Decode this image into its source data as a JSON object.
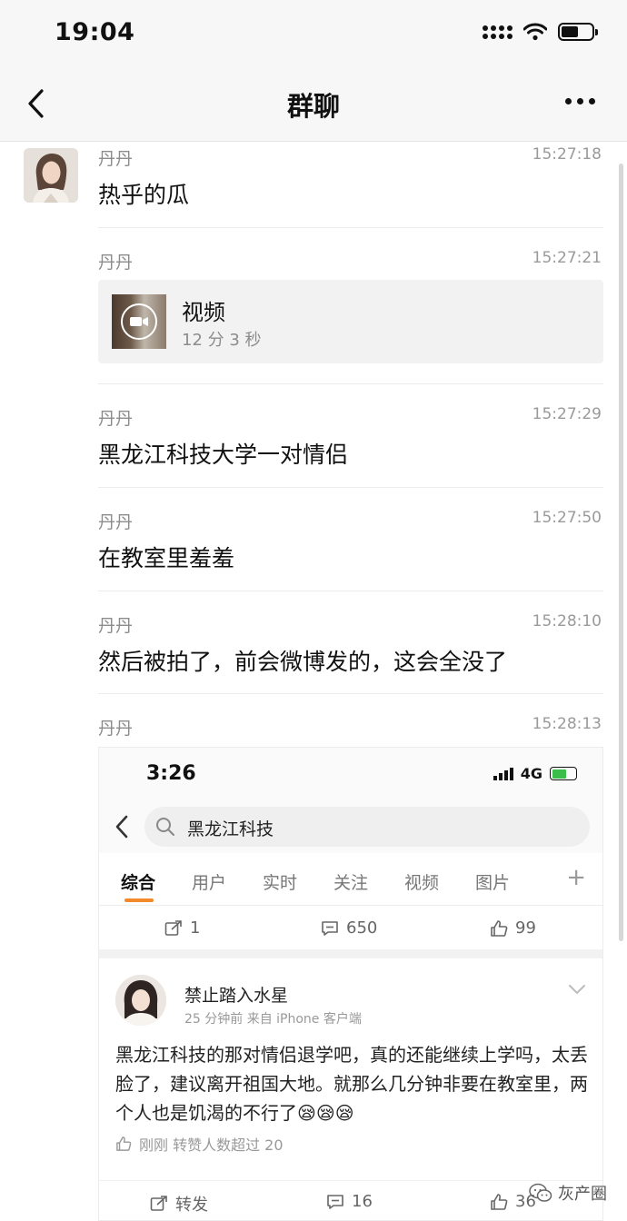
{
  "status_bar": {
    "time": "19:04"
  },
  "nav": {
    "title": "群聊"
  },
  "messages": [
    {
      "sender": "丹丹",
      "time": "15:27:18",
      "text": "热乎的瓜"
    },
    {
      "sender": "丹丹",
      "time": "15:27:21",
      "video": {
        "title": "视频",
        "duration": "12 分 3 秒"
      }
    },
    {
      "sender": "丹丹",
      "time": "15:27:29",
      "text": "黑龙江科技大学一对情侣"
    },
    {
      "sender": "丹丹",
      "time": "15:27:50",
      "text": "在教室里羞羞"
    },
    {
      "sender": "丹丹",
      "time": "15:28:10",
      "text": "然后被拍了，前会微博发的，这会全没了"
    },
    {
      "sender": "丹丹",
      "time": "15:28:13"
    }
  ],
  "screenshot": {
    "time": "3:26",
    "network": "4G",
    "search_query": "黑龙江科技",
    "tabs": [
      "综合",
      "用户",
      "实时",
      "关注",
      "视频",
      "图片"
    ],
    "plus": "+",
    "top_actions": {
      "repost": "1",
      "comments": "650",
      "likes": "99"
    },
    "post": {
      "author": "禁止踏入水星",
      "meta": "25 分钟前  来自 iPhone 客户端",
      "body": "黑龙江科技的那对情侣退学吧，真的还能继续上学吗，太丢脸了，建议离开祖国大地。就那么几分钟非要在教室里，两个人也是饥渴的不行了😪😪😪",
      "like_line": "刚刚 转赞人数超过 20",
      "actions": {
        "repost": "转发",
        "comments": "16",
        "likes": "36"
      }
    }
  },
  "watermark": "灰产圈"
}
